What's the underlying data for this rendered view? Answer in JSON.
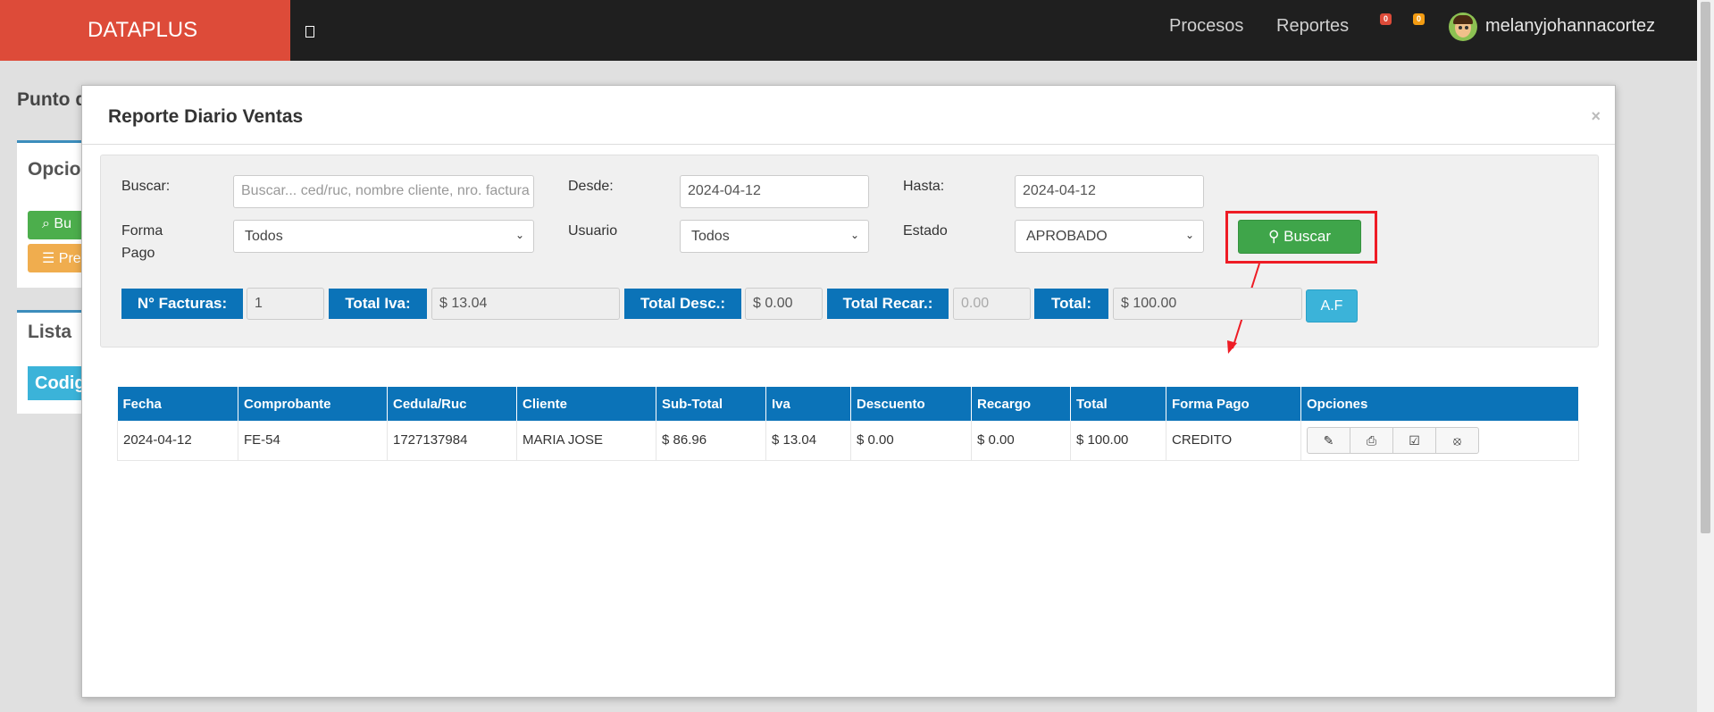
{
  "header": {
    "brand": "DATAPLUS",
    "toggle_icon": "menu-toggle-icon",
    "nav": [
      {
        "label": "Procesos"
      },
      {
        "label": "Reportes"
      }
    ],
    "badges": [
      {
        "count": "0",
        "color": "#dd4b39"
      },
      {
        "count": "0",
        "color": "#f39c12"
      }
    ],
    "username": "melanyjohannacortez"
  },
  "background": {
    "title_fragment": "Punto d",
    "box1_title": "Opcio",
    "btn1": "Bu",
    "btn2": "Pre",
    "box2_title": "Lista",
    "tab": "Codig"
  },
  "modal": {
    "title": "Reporte Diario Ventas",
    "close": "×",
    "filters": {
      "buscar_label": "Buscar:",
      "buscar_placeholder": "Buscar... ced/ruc, nombre cliente, nro. factura",
      "desde_label": "Desde:",
      "desde_value": "2024-04-12",
      "hasta_label": "Hasta:",
      "hasta_value": "2024-04-12",
      "forma_pago_label_1": "Forma",
      "forma_pago_label_2": "Pago",
      "forma_pago_value": "Todos",
      "usuario_label": "Usuario",
      "usuario_value": "Todos",
      "estado_label": "Estado",
      "estado_value": "APROBADO",
      "buscar_button": "Buscar"
    },
    "totals": {
      "facturas_label": "N° Facturas:",
      "facturas_value": "1",
      "iva_label": "Total Iva:",
      "iva_value": "$ 13.04",
      "desc_label": "Total Desc.:",
      "desc_value": "$ 0.00",
      "recar_label": "Total Recar.:",
      "recar_value": "0.00",
      "total_label": "Total:",
      "total_value": "$ 100.00",
      "af_button": "A.F"
    },
    "table": {
      "columns": [
        "Fecha",
        "Comprobante",
        "Cedula/Ruc",
        "Cliente",
        "Sub-Total",
        "Iva",
        "Descuento",
        "Recargo",
        "Total",
        "Forma Pago",
        "Opciones"
      ],
      "rows": [
        {
          "fecha": "2024-04-12",
          "comprobante": "FE-54",
          "cedula": "1727137984",
          "cliente": "MARIA JOSE",
          "subtotal": "$ 86.96",
          "iva": "$ 13.04",
          "descuento": "$ 0.00",
          "recargo": "$ 0.00",
          "total": "$ 100.00",
          "forma_pago": "CREDITO",
          "options": [
            "edit-icon",
            "print-icon",
            "approve-icon",
            "cancel-icon"
          ]
        }
      ]
    }
  },
  "annotation": {
    "color": "#ee1c25"
  }
}
